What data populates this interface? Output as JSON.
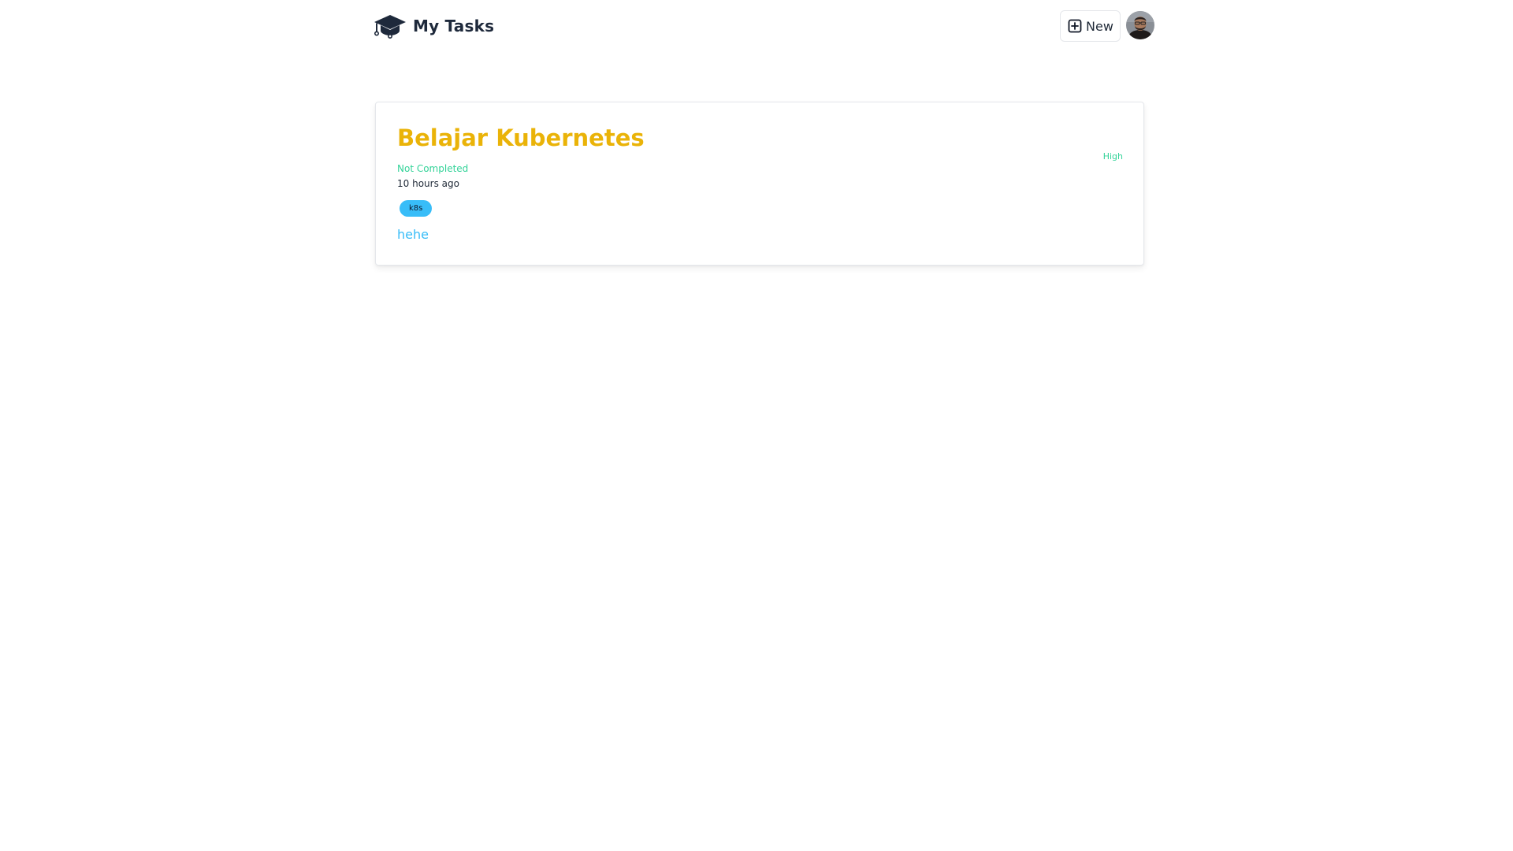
{
  "header": {
    "brand_icon": "graduation-cap-icon",
    "title": "My Tasks",
    "new_button": {
      "icon": "plus-square-icon",
      "label": "New"
    },
    "avatar": "user-avatar"
  },
  "tasks": [
    {
      "title": "Belajar Kubernetes",
      "status": "Not Completed",
      "time": "10 hours ago",
      "tags": [
        "k8s"
      ],
      "description": "hehe",
      "priority": "High"
    }
  ],
  "colors": {
    "title": "#eab308",
    "status": "#34d399",
    "tag_bg": "#38bdf8",
    "description": "#38bdf8",
    "priority": "#34d399"
  }
}
